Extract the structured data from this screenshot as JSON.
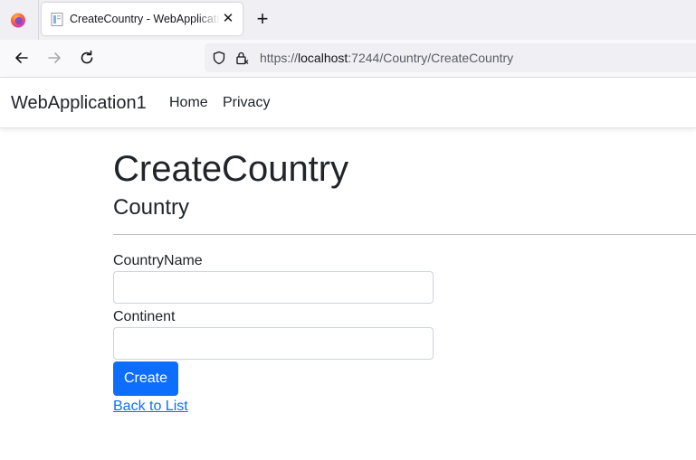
{
  "browser": {
    "tab_title": "CreateCountry - WebApplication1",
    "tab_close": "✕",
    "new_tab": "+",
    "url_scheme": "https://",
    "url_host": "localhost",
    "url_rest": ":7244/Country/CreateCountry",
    "icons": {
      "browser_logo": "firefox-icon",
      "tab_favicon": "page-icon",
      "back": "arrow-left-icon",
      "forward": "arrow-right-icon",
      "reload": "reload-icon",
      "tracking": "shield-icon",
      "security": "lock-icon"
    }
  },
  "site": {
    "brand": "WebApplication1",
    "nav": [
      "Home",
      "Privacy"
    ]
  },
  "page": {
    "title": "CreateCountry",
    "subtitle": "Country",
    "fields": [
      {
        "label": "CountryName",
        "value": "",
        "placeholder": ""
      },
      {
        "label": "Continent",
        "value": "",
        "placeholder": ""
      }
    ],
    "submit_label": "Create",
    "back_link": "Back to List"
  },
  "colors": {
    "primary": "#0d6efd",
    "text": "#212529",
    "tabstrip": "#f0f0f4",
    "toolbar": "#f9f9fb"
  }
}
